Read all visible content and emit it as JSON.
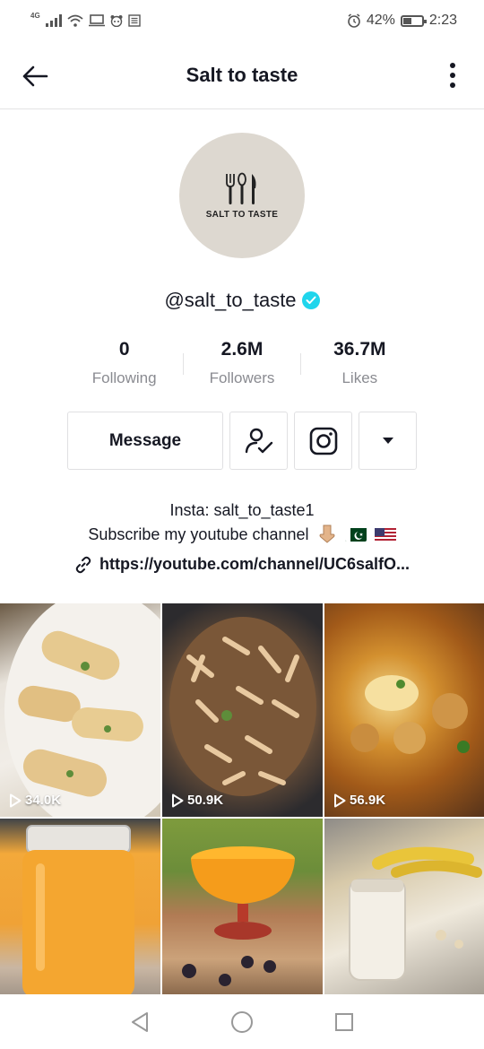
{
  "status_bar": {
    "network": "4G",
    "battery": "42%",
    "battery_level": 0.42,
    "time": "2:23",
    "icons": [
      "signal-icon",
      "wifi-icon",
      "laptop-icon",
      "panda-icon",
      "news-icon",
      "alarm-icon",
      "battery-icon"
    ]
  },
  "header": {
    "title": "Salt to taste"
  },
  "profile": {
    "avatar_text": "SALT TO TASTE",
    "username": "@salt_to_taste",
    "verified": true
  },
  "stats": [
    {
      "value": "0",
      "label": "Following"
    },
    {
      "value": "2.6M",
      "label": "Followers"
    },
    {
      "value": "36.7M",
      "label": "Likes"
    }
  ],
  "actions": {
    "message_label": "Message"
  },
  "bio": {
    "line1": "Insta: salt_to_taste1",
    "line2": "Subscribe my youtube channel",
    "link": "https://youtube.com/channel/UC6salfO..."
  },
  "videos": [
    {
      "views": "34.0K"
    },
    {
      "views": "50.9K"
    },
    {
      "views": "56.9K"
    },
    {
      "views": ""
    },
    {
      "views": ""
    },
    {
      "views": ""
    }
  ],
  "colors": {
    "text_primary": "#161823",
    "text_secondary": "#8a8b91",
    "verified": "#20d5ec",
    "divider": "#e3e3e4"
  }
}
